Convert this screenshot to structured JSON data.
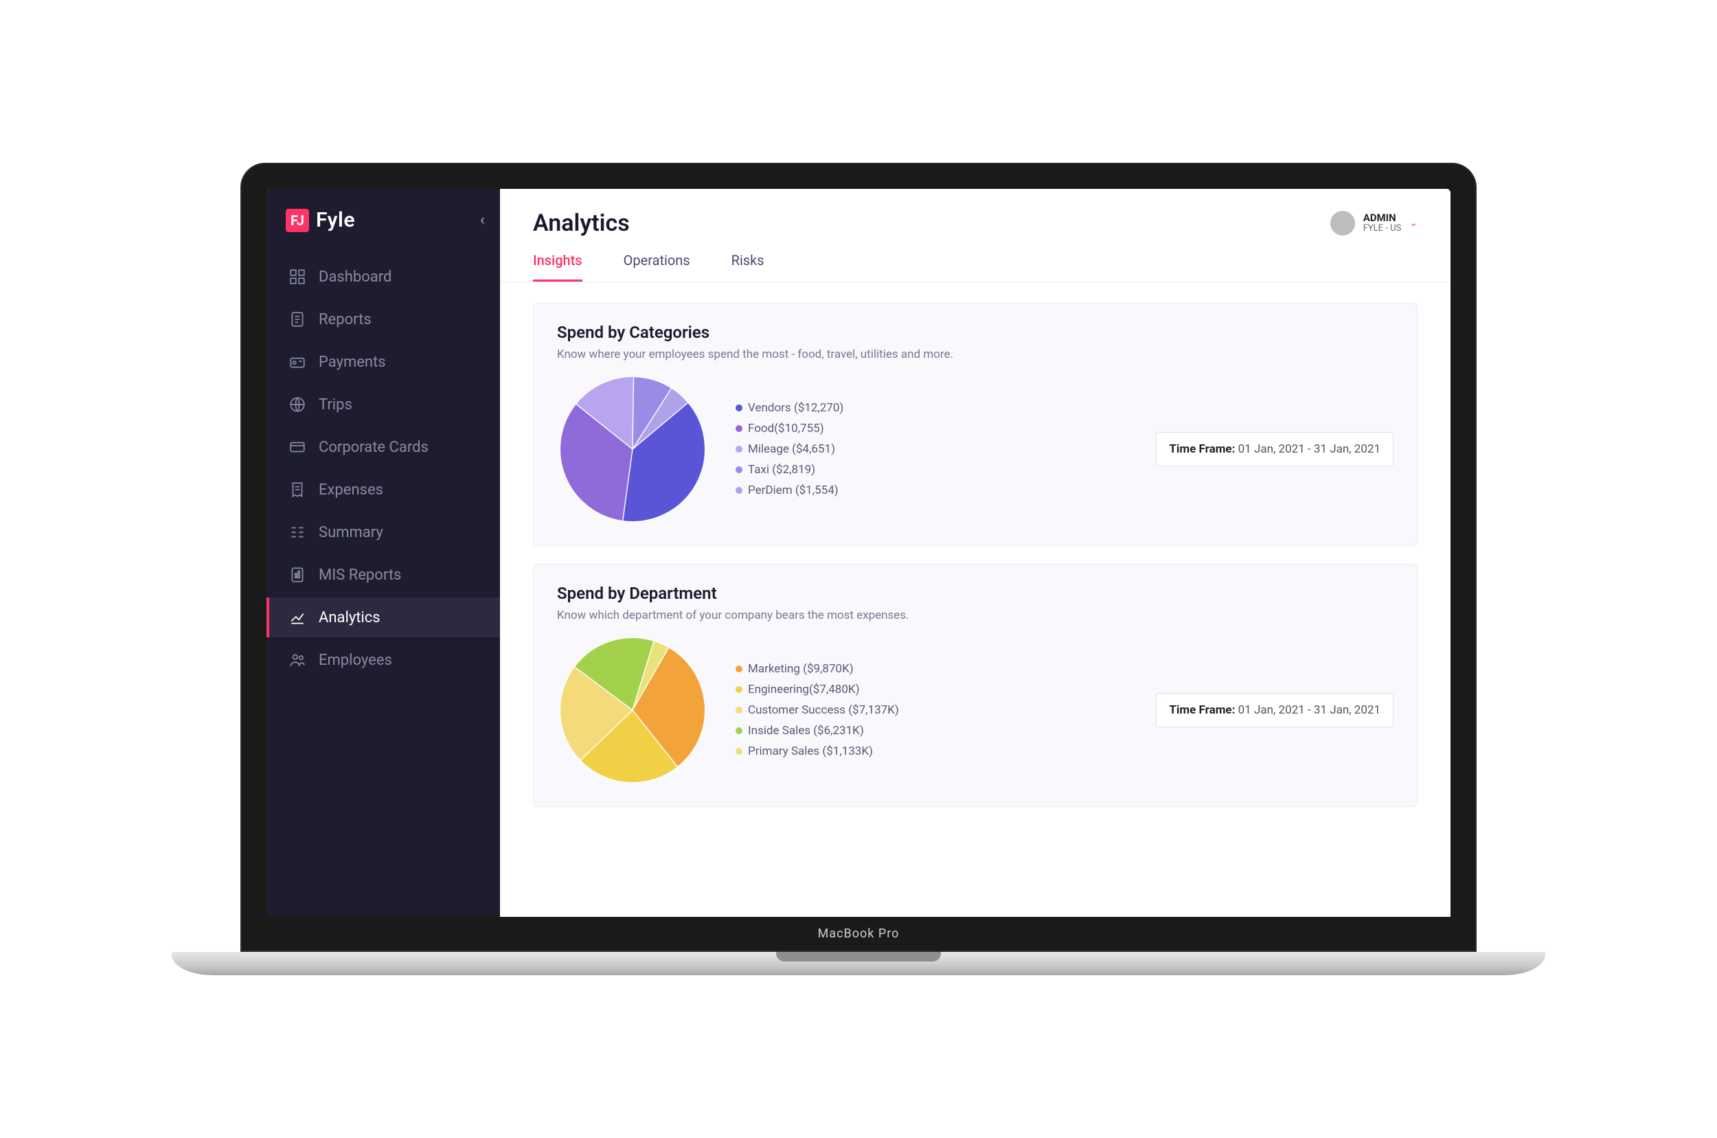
{
  "brand": {
    "name": "Fyle",
    "mark": "FJ"
  },
  "user": {
    "role": "ADMIN",
    "org": "FYLE - US"
  },
  "page_title": "Analytics",
  "laptop_label": "MacBook Pro",
  "sidebar": {
    "items": [
      {
        "id": "dashboard",
        "label": "Dashboard"
      },
      {
        "id": "reports",
        "label": "Reports"
      },
      {
        "id": "payments",
        "label": "Payments"
      },
      {
        "id": "trips",
        "label": "Trips"
      },
      {
        "id": "corporate-cards",
        "label": "Corporate Cards"
      },
      {
        "id": "expenses",
        "label": "Expenses"
      },
      {
        "id": "summary",
        "label": "Summary"
      },
      {
        "id": "mis-reports",
        "label": "MIS Reports"
      },
      {
        "id": "analytics",
        "label": "Analytics",
        "active": true
      },
      {
        "id": "employees",
        "label": "Employees"
      }
    ]
  },
  "tabs": [
    {
      "id": "insights",
      "label": "Insights",
      "active": true
    },
    {
      "id": "operations",
      "label": "Operations"
    },
    {
      "id": "risks",
      "label": "Risks"
    }
  ],
  "timeframe": {
    "label": "Time Frame:",
    "value": "01 Jan, 2021 - 31 Jan, 2021"
  },
  "cards": {
    "categories": {
      "title": "Spend by Categories",
      "subtitle": "Know where your employees spend the most - food, travel, utilities and more.",
      "legend": [
        {
          "label": "Vendors ($12,270)",
          "color": "#5a55d6"
        },
        {
          "label": "Food($10,755)",
          "color": "#8e6bd9"
        },
        {
          "label": "Mileage ($4,651)",
          "color": "#b9a4ef"
        },
        {
          "label": "Taxi ($2,819)",
          "color": "#9a8be6"
        },
        {
          "label": "PerDiem ($1,554)",
          "color": "#b0a2e9"
        }
      ]
    },
    "department": {
      "title": "Spend by Department",
      "subtitle": "Know which department of your company bears the most expenses.",
      "legend": [
        {
          "label": "Marketing ($9,870K)",
          "color": "#f2a43a"
        },
        {
          "label": "Engineering($7,480K)",
          "color": "#f0d146"
        },
        {
          "label": "Customer Success ($7,137K)",
          "color": "#f5da7a"
        },
        {
          "label": "Inside Sales ($6,231K)",
          "color": "#a3d14b"
        },
        {
          "label": "Primary Sales ($1,133K)",
          "color": "#e9e27a"
        }
      ]
    }
  },
  "chart_data": [
    {
      "type": "pie",
      "title": "Spend by Categories",
      "series": [
        {
          "name": "Vendors",
          "value": 12270,
          "color": "#5a55d6"
        },
        {
          "name": "Food",
          "value": 10755,
          "color": "#8e6bd9"
        },
        {
          "name": "Mileage",
          "value": 4651,
          "color": "#b9a4ef"
        },
        {
          "name": "Taxi",
          "value": 2819,
          "color": "#9a8be6"
        },
        {
          "name": "PerDiem",
          "value": 1554,
          "color": "#b0a2e9"
        }
      ]
    },
    {
      "type": "pie",
      "title": "Spend by Department",
      "series": [
        {
          "name": "Marketing",
          "value": 9870,
          "unit": "K",
          "color": "#f2a43a"
        },
        {
          "name": "Engineering",
          "value": 7480,
          "unit": "K",
          "color": "#f0d146"
        },
        {
          "name": "Customer Success",
          "value": 7137,
          "unit": "K",
          "color": "#f5da7a"
        },
        {
          "name": "Inside Sales",
          "value": 6231,
          "unit": "K",
          "color": "#a3d14b"
        },
        {
          "name": "Primary Sales",
          "value": 1133,
          "unit": "K",
          "color": "#e9e27a"
        }
      ]
    }
  ]
}
